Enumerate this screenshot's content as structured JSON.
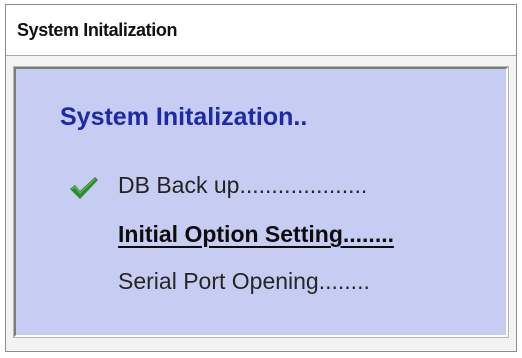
{
  "window": {
    "title": "System Initalization"
  },
  "panel": {
    "heading": "System Initalization.."
  },
  "steps": [
    {
      "label": "DB Back up....................",
      "status": "done",
      "icon": "checkmark-icon"
    },
    {
      "label": "Initial Option Setting........",
      "status": "in-progress"
    },
    {
      "label": "Serial Port Opening........",
      "status": "pending"
    }
  ],
  "colors": {
    "panel_background": "#c7ccf2",
    "heading": "#1d2aa8",
    "checkmark": "#2e8b2e"
  }
}
